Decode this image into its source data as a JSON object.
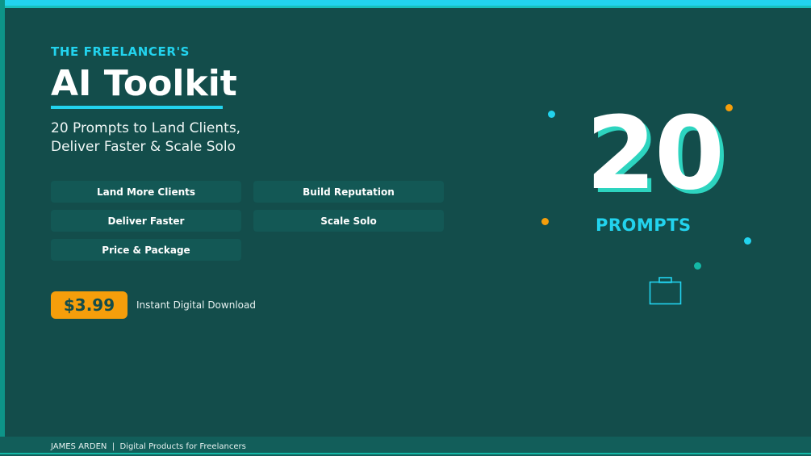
{
  "header": {
    "eyebrow": "THE FREELANCER'S",
    "title": "AI Toolkit",
    "subtitle_lines": [
      "20 Prompts to Land Clients,",
      "Deliver Faster & Scale Solo"
    ]
  },
  "features": [
    "Land More Clients",
    "Build Reputation",
    "Deliver Faster",
    "Scale Solo",
    "Price & Package"
  ],
  "offer": {
    "price": "$3.99",
    "note": "Instant Digital Download"
  },
  "hero": {
    "number": "20",
    "label": "PROMPTS"
  },
  "footer": {
    "author": "JAMES ARDEN",
    "separator": "|",
    "tagline": "Digital Products for Freelancers"
  },
  "colors": {
    "background": "#134d4b",
    "accent": "#22d3ee",
    "teal": "#14b8a6",
    "price_badge": "#f59e0b",
    "chip": "#135855"
  },
  "icons": [
    "briefcase-icon"
  ]
}
